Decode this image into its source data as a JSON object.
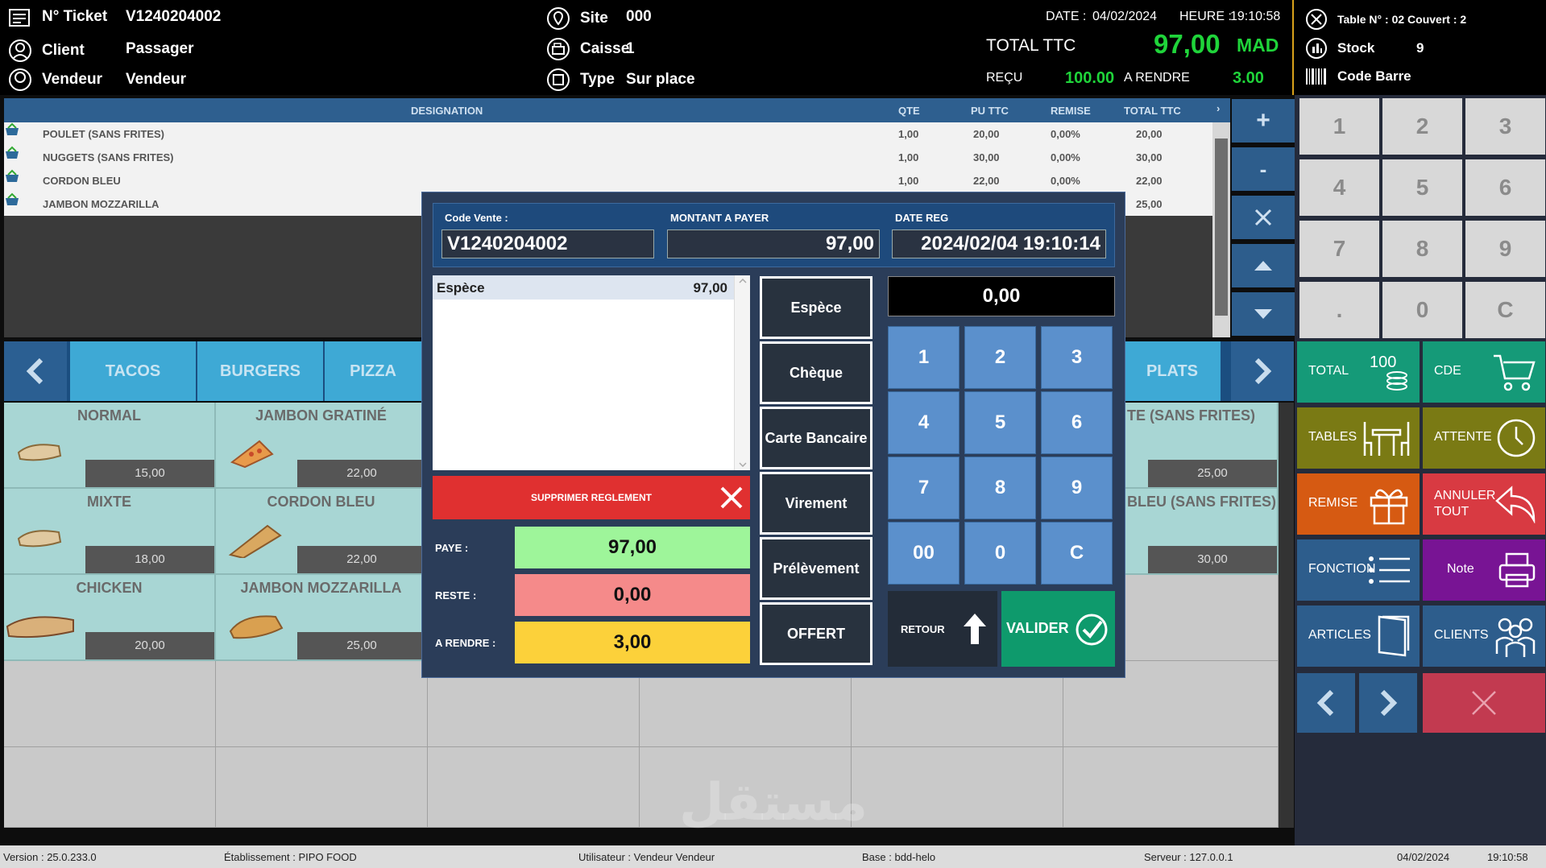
{
  "header": {
    "ticket_label": "N° Ticket",
    "ticket_value": "V1240204002",
    "client_label": "Client",
    "client_value": "Passager",
    "vendeur_label": "Vendeur",
    "vendeur_value": "Vendeur",
    "site_label": "Site",
    "site_value": "000",
    "caisse_label": "Caisse",
    "caisse_value": "1",
    "type_label": "Type",
    "type_value": "Sur place",
    "date_label": "DATE :",
    "date_value": "04/02/2024",
    "heure_label": "HEURE :",
    "heure_value": "19:10:58",
    "total_label": "TOTAL TTC",
    "total_value": "97,00",
    "currency": "MAD",
    "recu_label": "REÇU",
    "recu_value": "100.00",
    "rendre_label": "A RENDRE",
    "rendre_value": "3.00",
    "table_info": "Table N° : 02 Couvert : 2",
    "stock_label": "Stock",
    "stock_value": "9",
    "barcode_label": "Code Barre"
  },
  "order": {
    "columns": {
      "designation": "DESIGNATION",
      "qte": "QTE",
      "pu": "PU TTC",
      "remise": "REMISE",
      "total": "TOTAL TTC"
    },
    "rows": [
      {
        "name": "POULET (SANS FRITES)",
        "qte": "1,00",
        "pu": "20,00",
        "remise": "0,00%",
        "total": "20,00"
      },
      {
        "name": "NUGGETS (SANS FRITES)",
        "qte": "1,00",
        "pu": "30,00",
        "remise": "0,00%",
        "total": "30,00"
      },
      {
        "name": "CORDON BLEU",
        "qte": "1,00",
        "pu": "22,00",
        "remise": "0,00%",
        "total": "22,00"
      },
      {
        "name": "JAMBON MOZZARILLA",
        "qte": "",
        "pu": "",
        "remise": "",
        "total": "25,00"
      }
    ]
  },
  "side_controls": {
    "plus": "+",
    "minus": "-"
  },
  "categories": [
    "TACOS",
    "BURGERS",
    "PIZZA",
    "PLATS"
  ],
  "products": [
    {
      "name": "NORMAL",
      "price": "15,00"
    },
    {
      "name": "JAMBON GRATINÉ",
      "price": "22,00"
    },
    {
      "name": "MIXTE",
      "price": "18,00"
    },
    {
      "name": "CORDON BLEU",
      "price": "22,00"
    },
    {
      "name": "CHICKEN",
      "price": "20,00"
    },
    {
      "name": "JAMBON MOZZARILLA",
      "price": "25,00"
    },
    {
      "name": "TE (SANS FRITES)",
      "price": "25,00"
    },
    {
      "name": "BLEU (SANS FRITES)",
      "price": "30,00"
    }
  ],
  "keypad": [
    "1",
    "2",
    "3",
    "4",
    "5",
    "6",
    "7",
    "8",
    "9",
    ".",
    "0",
    "C"
  ],
  "functions": {
    "total": "TOTAL",
    "cde": "CDE",
    "tables": "TABLES",
    "attente": "ATTENTE",
    "remise": "REMISE",
    "annuler": "ANNULER TOUT",
    "fonction": "FONCTION",
    "note": "Note",
    "articles": "ARTICLES",
    "clients": "CLIENTS"
  },
  "dialog": {
    "code_label": "Code Vente :",
    "code_value": "V1240204002",
    "montant_label": "MONTANT A PAYER",
    "montant_value": "97,00",
    "date_label": "DATE REG",
    "date_value": "2024/02/04 19:10:14",
    "payment_method": "Espèce",
    "payment_amount": "97,00",
    "delete_label": "SUPPRIMER REGLEMENT",
    "paye_label": "PAYE :",
    "paye_value": "97,00",
    "reste_label": "RESTE :",
    "reste_value": "0,00",
    "rendre_label": "A RENDRE :",
    "rendre_value": "3,00",
    "modes": [
      "Espèce",
      "Chèque",
      "Carte Bancaire",
      "Virement",
      "Prélèvement",
      "OFFERT"
    ],
    "amount_display": "0,00",
    "numpad": [
      "1",
      "2",
      "3",
      "4",
      "5",
      "6",
      "7",
      "8",
      "9",
      "00",
      "0",
      "C"
    ],
    "retour_label": "RETOUR",
    "valider_label": "VALIDER"
  },
  "status": {
    "version": "Version : 25.0.233.0",
    "etablissement": "Établissement : PIPO FOOD",
    "utilisateur": "Utilisateur : Vendeur Vendeur",
    "base": "Base : bdd-helo",
    "serveur": "Serveur : 127.0.0.1",
    "date": "04/02/2024",
    "time": "19:10:58"
  },
  "colors": {
    "accent_green": "#1fd43a",
    "header_bg": "#000000",
    "dialog_bg": "#2b3d59",
    "valider": "#0e9a6c",
    "delete": "#e03030"
  }
}
